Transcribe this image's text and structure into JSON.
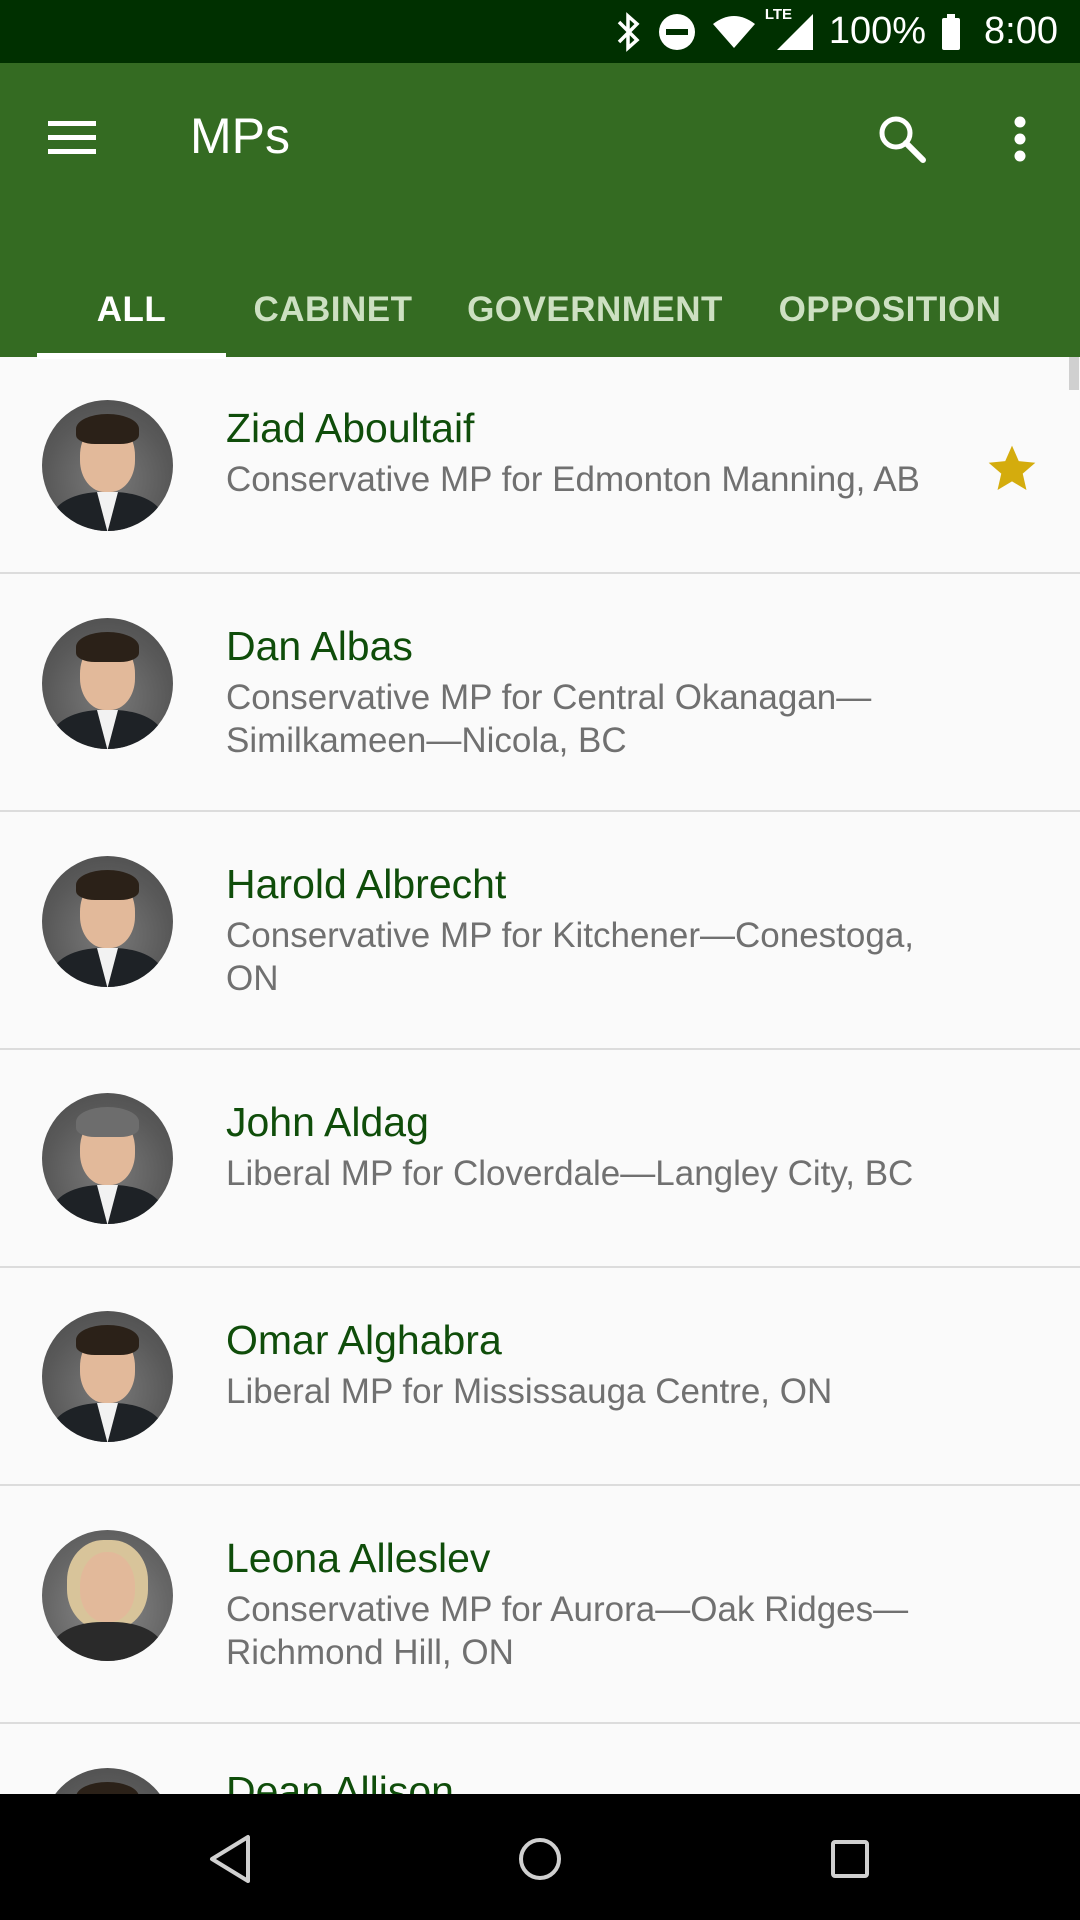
{
  "status_bar": {
    "battery_text": "100%",
    "time": "8:00",
    "network_label": "LTE",
    "icons": [
      "bluetooth-icon",
      "do-not-disturb-icon",
      "wifi-icon",
      "lte-signal-icon",
      "battery-icon"
    ]
  },
  "app_bar": {
    "title": "MPs",
    "color": "#346b22",
    "icons": [
      "menu-icon",
      "search-icon",
      "more-vert-icon"
    ]
  },
  "tabs": [
    {
      "label": "ALL",
      "active": true
    },
    {
      "label": "CABINET",
      "active": false
    },
    {
      "label": "GOVERNMENT",
      "active": false
    },
    {
      "label": "OPPOSITION",
      "active": false
    }
  ],
  "mps": [
    {
      "name": "Ziad Aboultaif",
      "desc_lines": [
        "Conservative MP for Edmonton Manning, AB"
      ],
      "favorite": true
    },
    {
      "name": "Dan Albas",
      "desc_lines": [
        "Conservative MP for Central Okanagan—",
        "Similkameen—Nicola, BC"
      ],
      "favorite": false
    },
    {
      "name": "Harold Albrecht",
      "desc_lines": [
        "Conservative MP for Kitchener—Conestoga,",
        "ON"
      ],
      "favorite": false
    },
    {
      "name": "John Aldag",
      "desc_lines": [
        "Liberal MP for Cloverdale—Langley City, BC"
      ],
      "favorite": false
    },
    {
      "name": "Omar Alghabra",
      "desc_lines": [
        "Liberal MP for Mississauga Centre, ON"
      ],
      "favorite": false
    },
    {
      "name": "Leona Alleslev",
      "desc_lines": [
        "Conservative MP for Aurora—Oak Ridges—",
        "Richmond Hill, ON"
      ],
      "favorite": false
    },
    {
      "name": "Dean Allison",
      "desc_lines": [],
      "favorite": false
    }
  ],
  "colors": {
    "status_bar": "#003000",
    "name_text": "#0f4d0a",
    "star": "#d4ac0d"
  },
  "nav_bar": {
    "icons": [
      "back-icon",
      "home-icon",
      "recents-icon"
    ]
  }
}
